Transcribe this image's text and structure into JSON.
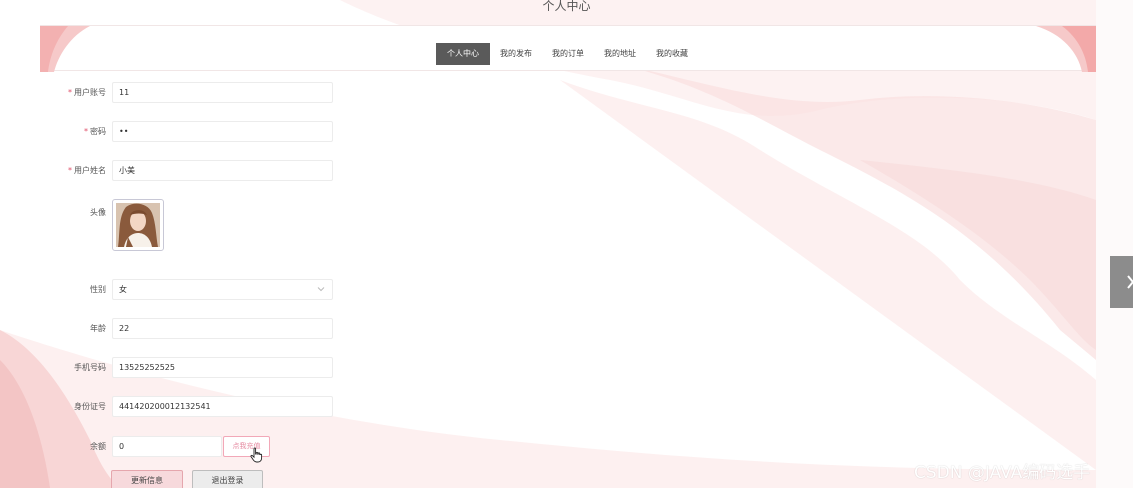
{
  "page": {
    "title": "个人中心"
  },
  "nav": {
    "tabs": [
      {
        "label": "个人中心",
        "active": true
      },
      {
        "label": "我的发布",
        "active": false
      },
      {
        "label": "我的订单",
        "active": false
      },
      {
        "label": "我的地址",
        "active": false
      },
      {
        "label": "我的收藏",
        "active": false
      }
    ]
  },
  "form": {
    "account": {
      "label": "用户账号",
      "value": "11",
      "required": true
    },
    "password": {
      "label": "密码",
      "value": "••",
      "required": true
    },
    "name": {
      "label": "用户姓名",
      "value": "小美",
      "required": true
    },
    "avatar": {
      "label": "头像"
    },
    "gender": {
      "label": "性别",
      "value": "女"
    },
    "age": {
      "label": "年龄",
      "value": "22"
    },
    "phone": {
      "label": "手机号码",
      "value": "13525252525"
    },
    "id_number": {
      "label": "身份证号",
      "value": "441420200012132541"
    },
    "balance": {
      "label": "余额",
      "value": "0",
      "recharge_label": "点我充值"
    }
  },
  "buttons": {
    "update_label": "更新信息",
    "logout_label": "退出登录"
  },
  "watermark": "CSDN @JAVA编码选手",
  "colors": {
    "accent": "#5a5a5a",
    "pink": "#f7d9dc",
    "required": "#e0506a"
  }
}
